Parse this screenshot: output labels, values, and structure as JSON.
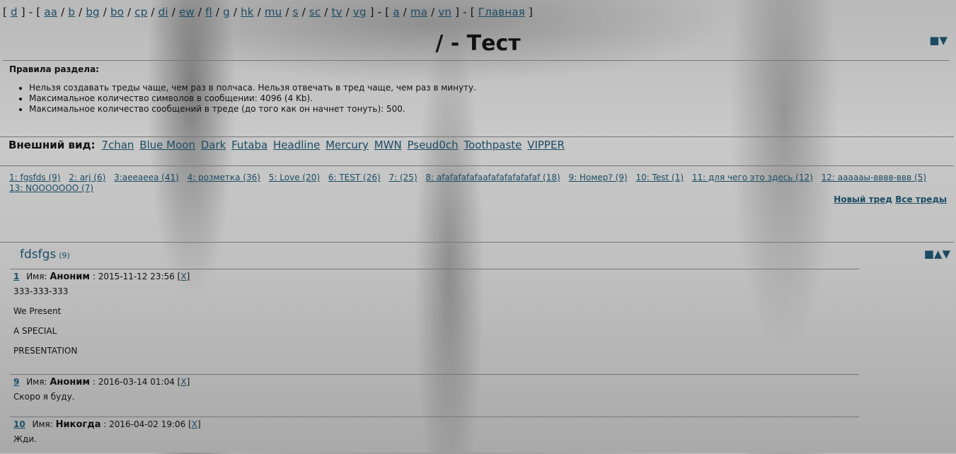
{
  "nav": {
    "groups": [
      [
        "d"
      ],
      [
        "aa",
        "b",
        "bg",
        "bo",
        "cp",
        "di",
        "ew",
        "fl",
        "g",
        "hk",
        "mu",
        "s",
        "sc",
        "tv",
        "vg"
      ],
      [
        "a",
        "ma",
        "vn"
      ],
      [
        "Главная"
      ]
    ]
  },
  "board_title": "/ - Тест",
  "top_arrows": "■▼",
  "rules": {
    "heading": "Правила раздела:",
    "items": [
      "Нельзя создавать треды чаще, чем раз в полчаса. Нельзя отвечать в тред чаще, чем раз в минуту.",
      "Максимальное количество символов в сообщении: 4096 (4 Kb).",
      "Максимальное количество сообщений в треде (до того как он начнет тонуть): 500."
    ]
  },
  "styles": {
    "label": "Внешний вид:",
    "items": [
      "7chan",
      "Blue Moon",
      "Dark",
      "Futaba",
      "Headline",
      "Mercury",
      "MWN",
      "Pseud0ch",
      "Toothpaste",
      "VIPPER"
    ]
  },
  "threads": [
    "1: fgsfds (9)",
    "2: arj (6)",
    "3:aeeaeea (41)",
    "4: розметка (36)",
    "5: Love (20)",
    "6: TEST (26)",
    "7: (25)",
    "8: afafafafafaafafafafafafaf (18)",
    "9: Номер? (9)",
    "10: Test (1)",
    "11: для чего это здесь (12)",
    "12: aaaaaы-вввв-ввв (5)",
    "13: NOOOOOOO (7)"
  ],
  "actions": {
    "new_thread": "Новый тред",
    "all_threads": "Все треды"
  },
  "thread": {
    "title": "fdsfgs",
    "count": "(9)",
    "arrows": "■▲▼",
    "posts": [
      {
        "num": "1",
        "name_label": "Имя:",
        "name": "Аноним",
        "date": ": 2015-11-12 23:56",
        "del": "X",
        "lines": [
          "333-333-333",
          "We Present",
          "A SPECIAL",
          "PRESENTATION"
        ]
      },
      {
        "num": "9",
        "name_label": "Имя:",
        "name": "Аноним",
        "date": ": 2016-03-14 01:04",
        "del": "X",
        "lines": [
          "Скоро я буду."
        ]
      },
      {
        "num": "10",
        "name_label": "Имя:",
        "name": "Никогда",
        "date": ": 2016-04-02 19:06",
        "del": "X",
        "lines": [
          "Жди."
        ]
      }
    ]
  }
}
